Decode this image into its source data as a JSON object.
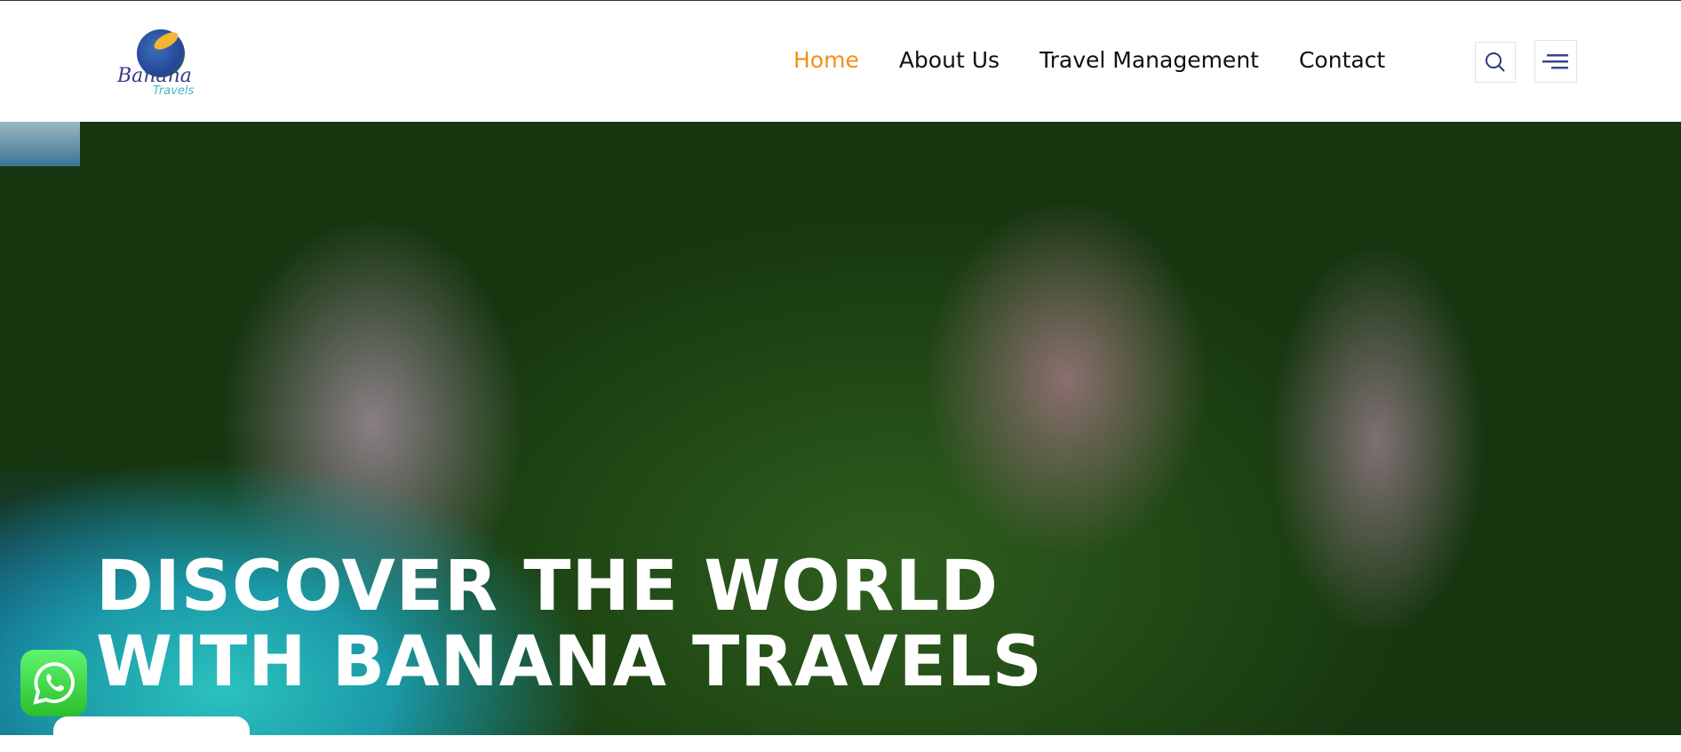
{
  "brand": {
    "name": "Banana",
    "tagline": "Travels"
  },
  "nav": {
    "items": [
      {
        "label": "Home",
        "active": true
      },
      {
        "label": "About Us"
      },
      {
        "label": "Travel Management"
      },
      {
        "label": "Contact"
      }
    ]
  },
  "hero": {
    "line1": "DISCOVER THE WORLD",
    "line2": "WITH BANANA TRAVELS"
  },
  "colors": {
    "accent": "#f39019",
    "icon": "#2b3a7a",
    "whatsapp": "#3fd24a"
  }
}
